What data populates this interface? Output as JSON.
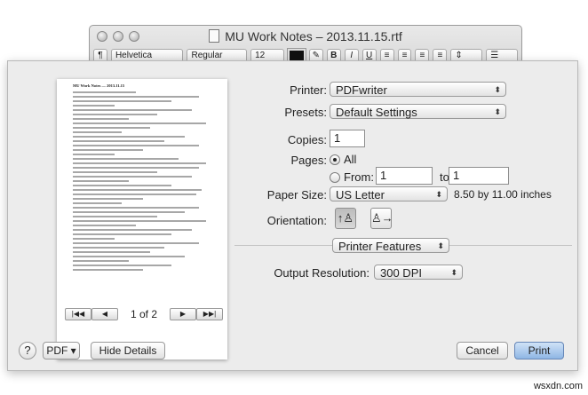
{
  "window": {
    "title": "MU Work Notes – 2013.11.15.rtf",
    "format_bar": {
      "paragraph_style": "¶",
      "font_family": "Helvetica",
      "font_style": "Regular",
      "font_size": "12",
      "bold": "B",
      "italic": "I",
      "underline": "U"
    }
  },
  "preview": {
    "doc_title": "MU Work Notes — 2013.11.15",
    "page_indicator": "1 of 2",
    "first_page": "|◀◀",
    "prev_page": "◀",
    "next_page": "▶",
    "last_page": "▶▶|"
  },
  "print": {
    "printer_label": "Printer:",
    "printer_value": "PDFwriter",
    "presets_label": "Presets:",
    "presets_value": "Default Settings",
    "copies_label": "Copies:",
    "copies_value": "1",
    "pages_label": "Pages:",
    "all_label": "All",
    "from_label": "From:",
    "from_value": "1",
    "to_label": "to:",
    "to_value": "1",
    "pages_selected": "All",
    "paper_size_label": "Paper Size:",
    "paper_size_value": "US Letter",
    "paper_dimensions": "8.50 by 11.00 inches",
    "orientation_label": "Orientation:",
    "orientation_selected": "portrait",
    "section_value": "Printer Features",
    "output_resolution_label": "Output Resolution:",
    "output_resolution_value": "300 DPI"
  },
  "footer": {
    "help": "?",
    "pdf_button": "PDF ▾",
    "hide_details": "Hide Details",
    "cancel": "Cancel",
    "print": "Print"
  },
  "watermark": "wsxdn.com"
}
